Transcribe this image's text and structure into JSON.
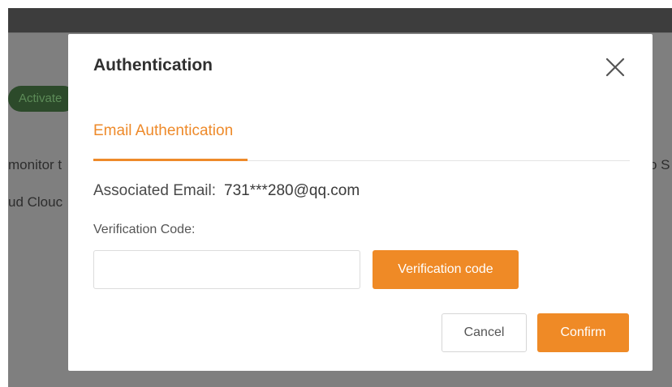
{
  "background": {
    "badge_text": "Activate",
    "text_left_1": "monitor t",
    "text_left_2": "ud Clouc",
    "text_right_1": "o S"
  },
  "modal": {
    "title": "Authentication",
    "close_icon": "close-icon",
    "tabs": [
      {
        "label": "Email Authentication",
        "active": true
      }
    ],
    "email_label": "Associated Email:",
    "email_value": "731***280@qq.com",
    "code_label": "Verification Code:",
    "code_input_value": "",
    "code_input_placeholder": "",
    "send_code_button_label": "Verification code",
    "cancel_button_label": "Cancel",
    "confirm_button_label": "Confirm"
  },
  "colors": {
    "accent": "#ef8a26",
    "overlay": "#7f7f7f"
  }
}
